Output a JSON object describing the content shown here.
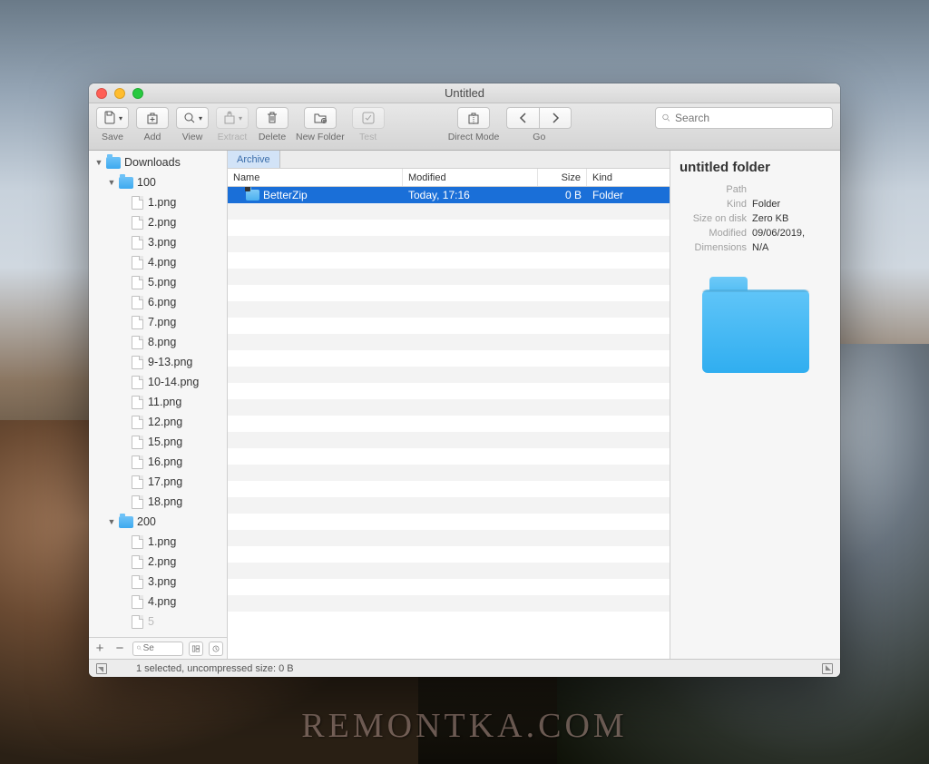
{
  "window": {
    "title": "Untitled"
  },
  "toolbar": {
    "save": "Save",
    "add": "Add",
    "view": "View",
    "extract": "Extract",
    "delete": "Delete",
    "newfolder": "New Folder",
    "test": "Test",
    "directmode": "Direct Mode",
    "go": "Go",
    "search_placeholder": "Search"
  },
  "sidebar": {
    "root": "Downloads",
    "folders": [
      {
        "name": "100",
        "files": [
          "1.png",
          "2.png",
          "3.png",
          "4.png",
          "5.png",
          "6.png",
          "7.png",
          "8.png",
          "9-13.png",
          "10-14.png",
          "11.png",
          "12.png",
          "15.png",
          "16.png",
          "17.png",
          "18.png"
        ]
      },
      {
        "name": "200",
        "files": [
          "1.png",
          "2.png",
          "3.png",
          "4.png"
        ]
      }
    ],
    "filter_placeholder": "Se"
  },
  "tabs": {
    "active": "Archive"
  },
  "columns": {
    "name": "Name",
    "modified": "Modified",
    "size": "Size",
    "kind": "Kind"
  },
  "rows": [
    {
      "name": "BetterZip",
      "modified": "Today, 17:16",
      "size": "0 B",
      "kind": "Folder",
      "selected": true
    }
  ],
  "inspector": {
    "title": "untitled folder",
    "labels": {
      "path": "Path",
      "kind": "Kind",
      "size": "Size on disk",
      "modified": "Modified",
      "dimensions": "Dimensions"
    },
    "values": {
      "path": "",
      "kind": "Folder",
      "size": "Zero KB",
      "modified": "09/06/2019,",
      "dimensions": "N/A"
    }
  },
  "status": "1 selected, uncompressed size: 0 B",
  "watermark": "REMONTKA.COM"
}
